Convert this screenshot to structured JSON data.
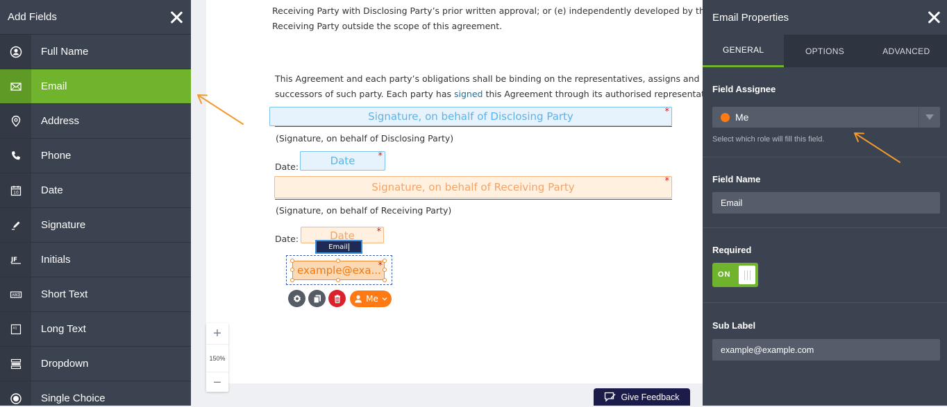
{
  "left_panel": {
    "title": "Add Fields",
    "items": [
      {
        "label": "Full Name",
        "icon": "user-circle-icon"
      },
      {
        "label": "Email",
        "icon": "envelope-icon"
      },
      {
        "label": "Address",
        "icon": "map-pin-icon"
      },
      {
        "label": "Phone",
        "icon": "phone-icon"
      },
      {
        "label": "Date",
        "icon": "calendar-icon"
      },
      {
        "label": "Signature",
        "icon": "pen-icon"
      },
      {
        "label": "Initials",
        "icon": "initials-icon"
      },
      {
        "label": "Short Text",
        "icon": "short-text-icon"
      },
      {
        "label": "Long Text",
        "icon": "long-text-icon"
      },
      {
        "label": "Dropdown",
        "icon": "dropdown-icon"
      },
      {
        "label": "Single Choice",
        "icon": "radio-icon"
      }
    ],
    "active_item": "Email"
  },
  "document": {
    "para1_line1": "Receiving Party with Disclosing Party’s prior written approval; or (e) independently developed by the",
    "para1_line2": "Receiving Party outside the scope of this agreement.",
    "para2_line1": "This Agreement and each party’s obligations shall be binding on the representatives, assigns and",
    "para2_line2_before": "successors of such party. Each party has ",
    "para2_line2_link": "signed",
    "para2_line2_after": " this Agreement through its authorised representative",
    "sig_disclosing_placeholder": "Signature, on behalf of Disclosing Party",
    "sig_disclosing_caption": "(Signature, on behalf of Disclosing Party)",
    "date_label_1": "Date:",
    "date_placeholder_1": "Date",
    "sig_receiving_placeholder": "Signature, on behalf of Receiving Party",
    "sig_receiving_caption": "(Signature, on behalf of Receiving Party)",
    "date_label_2": "Date:",
    "date_placeholder_2": "Date",
    "required_mark": "*",
    "tooltip": "Email",
    "email_field_value": "example@exa...",
    "assignee_pill": "Me"
  },
  "zoom": {
    "plus": "+",
    "level": "150%",
    "minus": "−"
  },
  "feedback_label": "Give Feedback",
  "right_panel": {
    "title": "Email Properties",
    "tabs": [
      "GENERAL",
      "OPTIONS",
      "ADVANCED"
    ],
    "active_tab": "GENERAL",
    "field_assignee_label": "Field Assignee",
    "assignee_value": "Me",
    "assignee_hint": "Select which role will fill this field.",
    "field_name_label": "Field Name",
    "field_name_value": "Email",
    "required_label": "Required",
    "required_toggle": "ON",
    "sub_label_label": "Sub Label",
    "sub_label_value": "example@example.com"
  },
  "colors": {
    "panel_bg": "#3b4350",
    "accent_green": "#6fb42c",
    "assignee_orange": "#ff7a12",
    "annotation_arrow": "#f39a2b"
  }
}
